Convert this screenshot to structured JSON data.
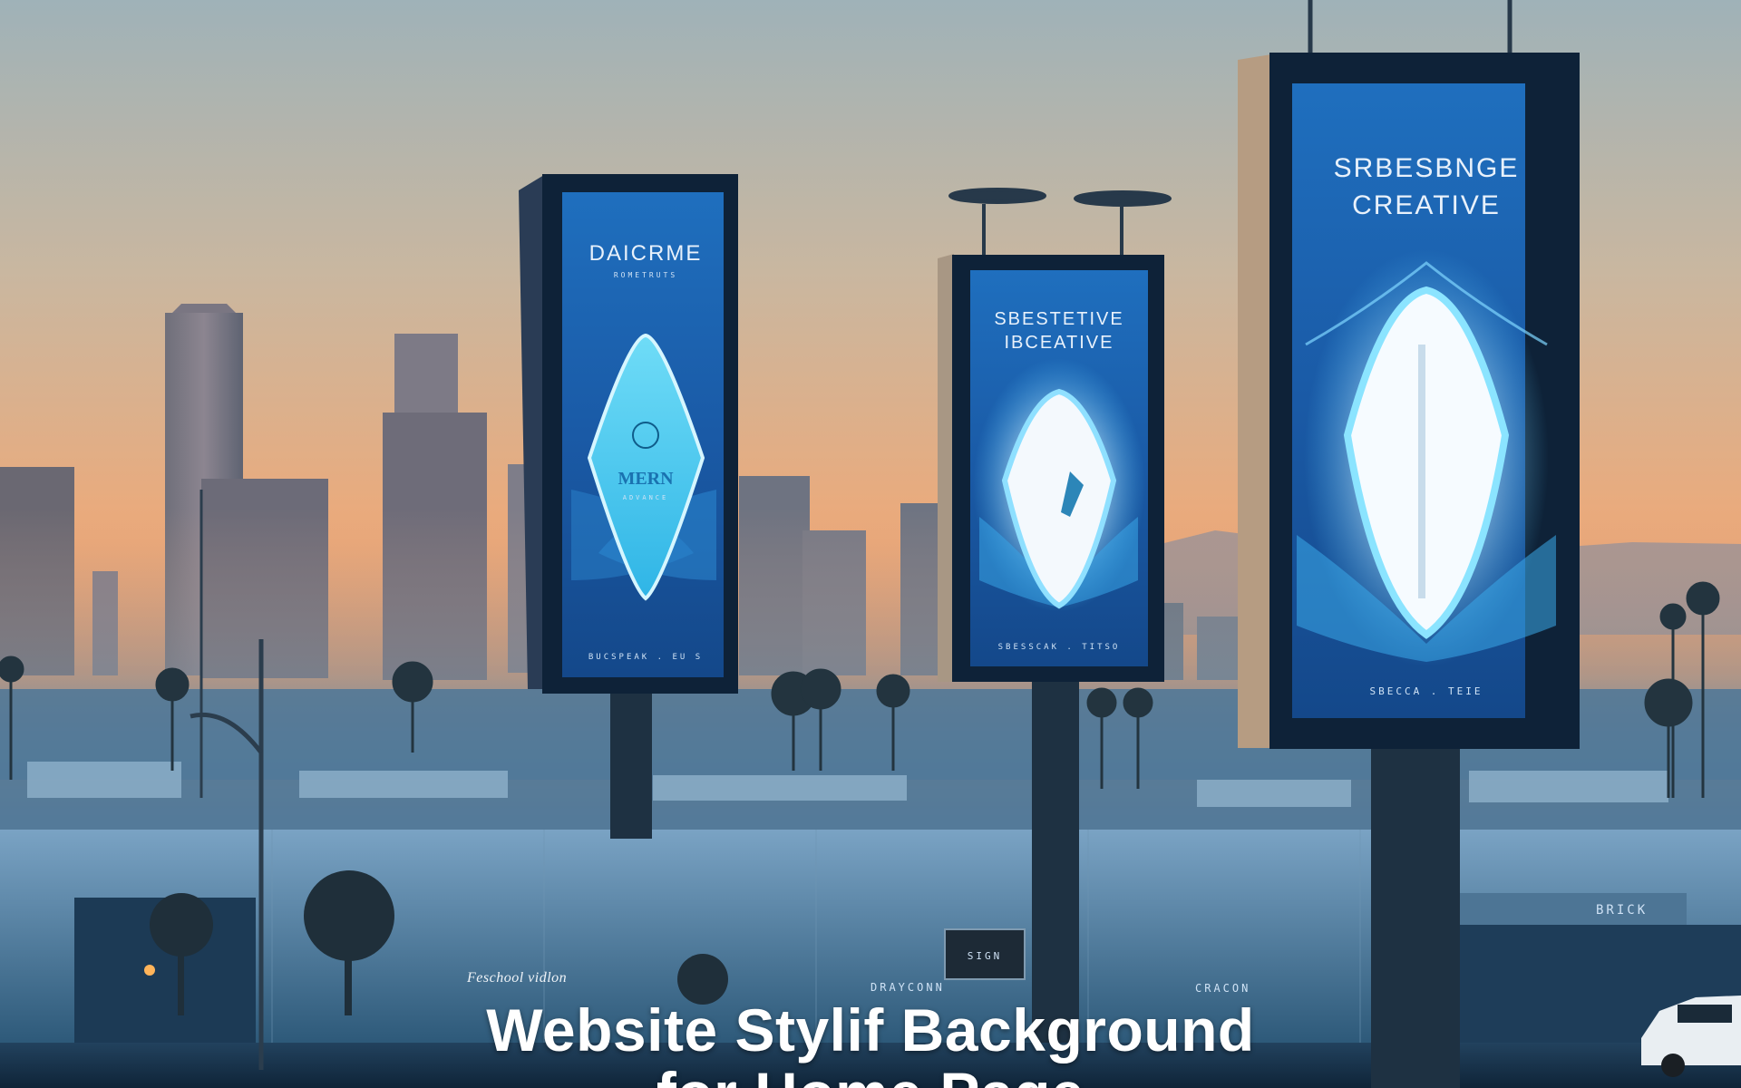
{
  "billboards": {
    "left": {
      "title": "DAICRME",
      "sub": "ROMETRUTS",
      "center": "MERN",
      "center_sub": "ADVANCE",
      "footer": "BUCSPEAK . EU S"
    },
    "middle": {
      "title1": "SBESTETIVE",
      "title2": "IBCEATIVE",
      "footer": "SBESSCAK . TITSO"
    },
    "right": {
      "title1": "SRBESBNGE",
      "title2": "CREATIVE",
      "footer": "SBECCA . TEIE"
    }
  },
  "signs": {
    "building": "BRICK",
    "street": "SIGN",
    "road_left": "DRAYCONN",
    "road_right": "CRACON"
  },
  "caption": {
    "kicker": "Feschool vidlon",
    "line1": "Website Stylif Background",
    "line2": "for Home Page"
  },
  "colors": {
    "sky_top": "#9fb2b8",
    "sky_bottom": "#e8a070",
    "billboard_blue": "#1c5fae",
    "glow": "#5fd0ff",
    "city": "#3f6b8c"
  }
}
